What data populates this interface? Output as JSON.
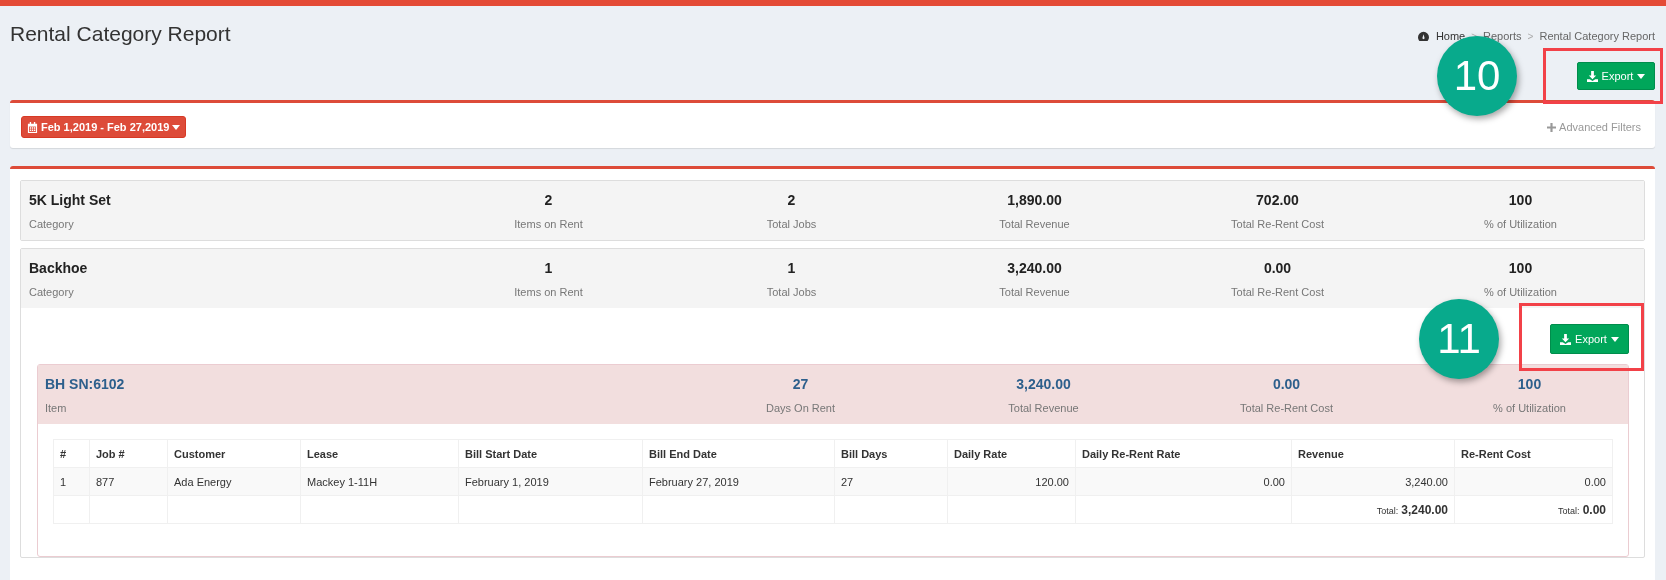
{
  "header": {
    "title": "Rental Category Report",
    "breadcrumb": [
      "Home",
      "Reports",
      "Rental Category Report"
    ],
    "separator": ">"
  },
  "top_export": {
    "label": "Export",
    "callout": "10"
  },
  "filters": {
    "date_range": "Feb 1,2019 - Feb 27,2019",
    "advanced_filters": "Advanced Filters"
  },
  "categories": [
    {
      "name": "5K Light Set",
      "subtitle": "Category",
      "stats": [
        {
          "value": "2",
          "label": "Items on Rent"
        },
        {
          "value": "2",
          "label": "Total Jobs"
        },
        {
          "value": "1,890.00",
          "label": "Total Revenue"
        },
        {
          "value": "702.00",
          "label": "Total Re-Rent Cost"
        },
        {
          "value": "100",
          "label": "% of Utilization"
        }
      ]
    },
    {
      "name": "Backhoe",
      "subtitle": "Category",
      "stats": [
        {
          "value": "1",
          "label": "Items on Rent"
        },
        {
          "value": "1",
          "label": "Total Jobs"
        },
        {
          "value": "3,240.00",
          "label": "Total Revenue"
        },
        {
          "value": "0.00",
          "label": "Total Re-Rent Cost"
        },
        {
          "value": "100",
          "label": "% of Utilization"
        }
      ],
      "detail": {
        "export": {
          "label": "Export",
          "callout": "11"
        },
        "items": [
          {
            "name": "BH SN:6102",
            "subtitle": "Item",
            "stats": [
              {
                "value": "27",
                "label": "Days On Rent"
              },
              {
                "value": "3,240.00",
                "label": "Total Revenue"
              },
              {
                "value": "0.00",
                "label": "Total Re-Rent Cost"
              },
              {
                "value": "100",
                "label": "% of Utilization"
              }
            ],
            "table": {
              "columns": [
                {
                  "label": "#",
                  "kind": "text"
                },
                {
                  "label": "Job #",
                  "kind": "text"
                },
                {
                  "label": "Customer",
                  "kind": "text"
                },
                {
                  "label": "Lease",
                  "kind": "text"
                },
                {
                  "label": "Bill Start Date",
                  "kind": "text"
                },
                {
                  "label": "Bill End Date",
                  "kind": "text"
                },
                {
                  "label": "Bill Days",
                  "kind": "text"
                },
                {
                  "label": "Daily Rate",
                  "kind": "number"
                },
                {
                  "label": "Daily Re-Rent Rate",
                  "kind": "number"
                },
                {
                  "label": "Revenue",
                  "kind": "number"
                },
                {
                  "label": "Re-Rent Cost",
                  "kind": "number"
                }
              ],
              "rows": [
                [
                  "1",
                  "877",
                  "Ada Energy",
                  "Mackey 1-11H",
                  "February 1, 2019",
                  "February 27, 2019",
                  "27",
                  "120.00",
                  "0.00",
                  "3,240.00",
                  "0.00"
                ]
              ],
              "totals": [
                {
                  "label": "Total:",
                  "value": "3,240.00"
                },
                {
                  "label": "Total:",
                  "value": "0.00"
                }
              ]
            }
          }
        ]
      }
    }
  ]
}
